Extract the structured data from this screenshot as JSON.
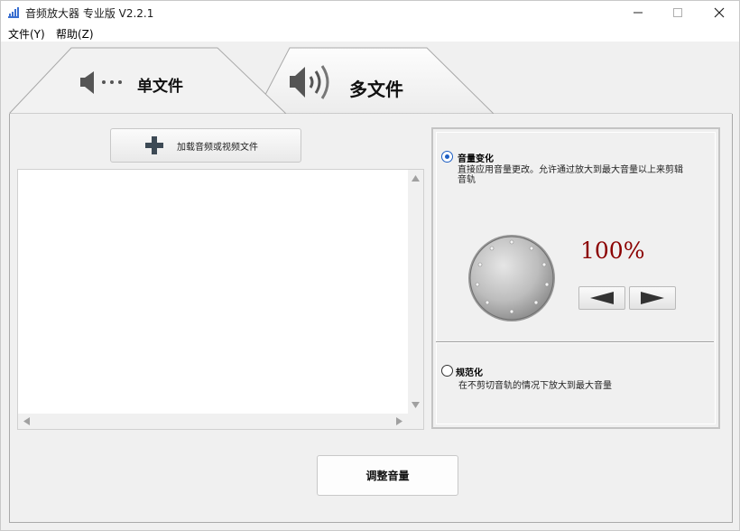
{
  "window": {
    "title": "音频放大器 专业版 V2.2.1"
  },
  "menu": {
    "file": "文件(Y)",
    "help": "帮助(Z)"
  },
  "tabs": [
    {
      "label": "单文件",
      "selected": true,
      "icon": "speaker-dots-icon"
    },
    {
      "label": "多文件",
      "selected": false,
      "icon": "speaker-waves-icon"
    }
  ],
  "files": {
    "load_button": "加载音频或视频文件",
    "items": []
  },
  "options": {
    "volume_change": {
      "title": "音量变化",
      "desc": "直接应用音量更改。允许通过放大到最大音量以上来剪辑音轨",
      "selected": true
    },
    "normalize": {
      "title": "规范化",
      "desc": "在不剪切音轨的情况下放大到最大音量",
      "selected": false
    }
  },
  "volume": {
    "percent": "100%"
  },
  "actions": {
    "adjust": "调整音量"
  },
  "colors": {
    "percent": "#8b0000",
    "radio_accent": "#1e5fc4"
  }
}
